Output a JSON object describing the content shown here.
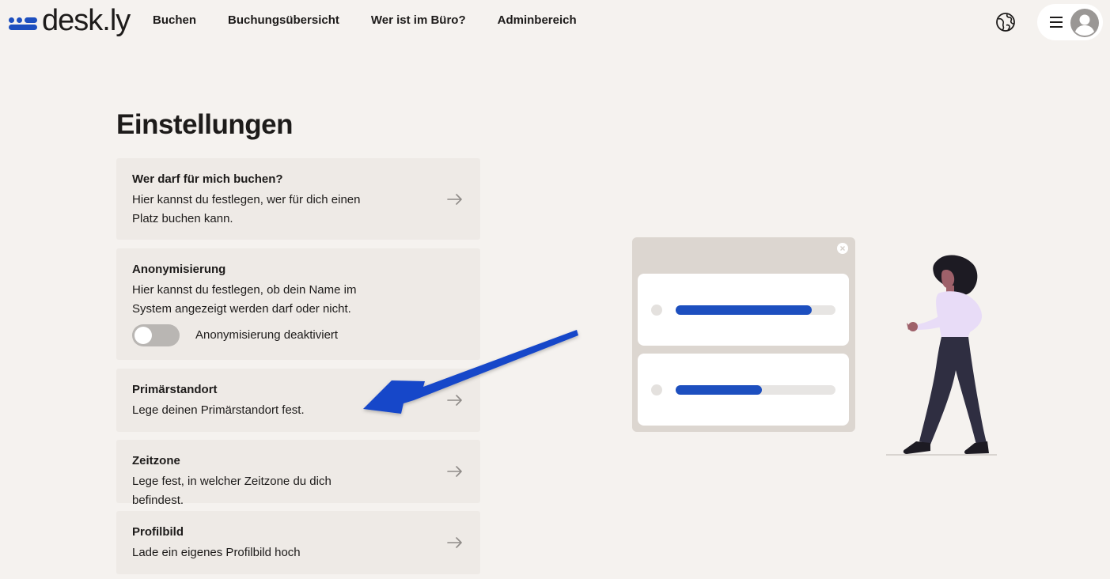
{
  "brand": {
    "name": "desk.ly",
    "mark_color": "#1d4fbf"
  },
  "nav": {
    "links": [
      "Buchen",
      "Buchungsübersicht",
      "Wer ist im Büro?",
      "Adminbereich"
    ],
    "language_icon": "globe-icon",
    "menu_icon": "hamburger-icon",
    "avatar_icon": "user-avatar-icon"
  },
  "page": {
    "title": "Einstellungen"
  },
  "settings": [
    {
      "title": "Wer darf für mich buchen?",
      "desc": "Hier kannst du festlegen, wer für dich einen Platz buchen kann.",
      "icon": "arrow-right-icon"
    },
    {
      "title": "Anonymisierung",
      "desc": "Hier kannst du festlegen, ob dein Name im System angezeigt werden darf oder nicht.",
      "toggle_label": "Anonymisierung deaktiviert",
      "toggle_on": false
    },
    {
      "title": "Primärstandort",
      "desc": "Lege deinen Primärstandort fest.",
      "icon": "arrow-right-icon"
    },
    {
      "title": "Zeitzone",
      "desc": "Lege fest, in welcher Zeitzone du dich befindest.",
      "icon": "arrow-right-icon"
    },
    {
      "title": "Profilbild",
      "desc": "Lade ein eigenes Profilbild hoch",
      "icon": "arrow-right-icon"
    }
  ],
  "illustration": {
    "progress_bars": [
      0.85,
      0.54
    ],
    "accent": "#1d4fbf",
    "panel_color": "#dcd6d0"
  },
  "annotation": {
    "color": "#1747c9",
    "points_to": "Primärstandort"
  }
}
